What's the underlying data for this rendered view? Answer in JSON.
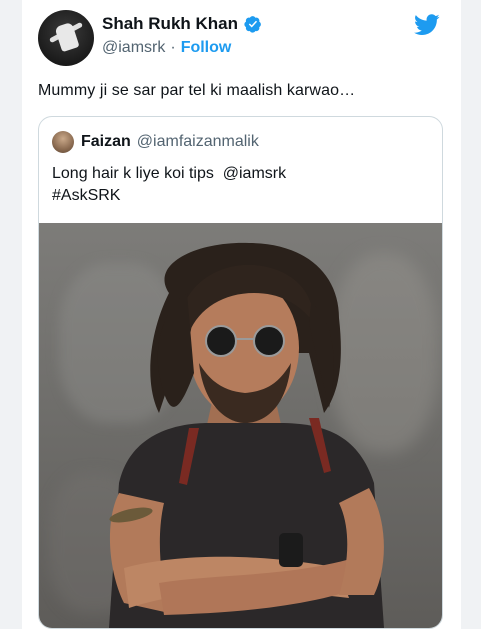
{
  "tweet": {
    "author": {
      "display_name": "Shah Rukh Khan",
      "handle": "@iamsrk",
      "separator": "·",
      "follow_label": "Follow",
      "verified": true,
      "verified_icon": "verified-badge-icon"
    },
    "platform_icon": "twitter-bird-icon",
    "text": "Mummy ji se sar par tel ki maalish karwao…",
    "quoted": {
      "display_name": "Faizan",
      "handle": "@iamfaizanmalik",
      "text_lines": [
        "Long hair k liye koi tips  @iamsrk",
        "#AskSRK"
      ],
      "media": "photo"
    }
  },
  "colors": {
    "accent": "#1d9bf0",
    "text_primary": "#0f1419",
    "text_secondary": "#536471",
    "border": "#cfd9de"
  }
}
